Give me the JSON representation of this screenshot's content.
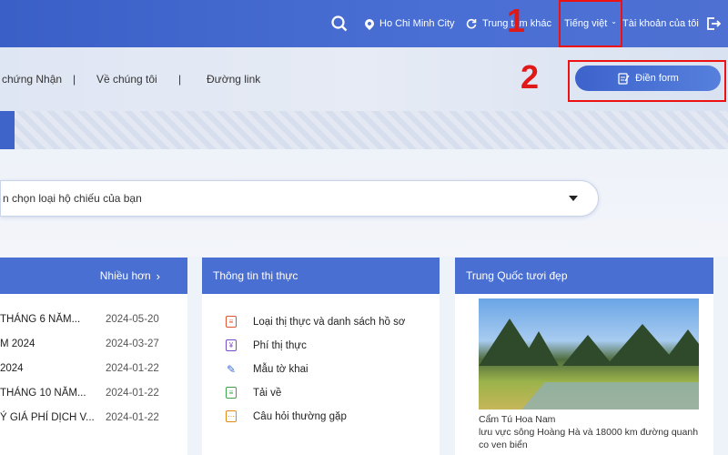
{
  "topbar": {
    "location": "Ho Chi Minh City",
    "other_label": "Trung tâm khác",
    "language": "Tiếng việt",
    "account": "Tài khoản của tôi"
  },
  "annotations": {
    "one": "1",
    "two": "2"
  },
  "nav": {
    "links": [
      "chứng Nhận",
      "Về chúng tôi",
      "Đường link"
    ],
    "separators": [
      "|",
      "|"
    ],
    "fill_form": "Điền form"
  },
  "passport_select": {
    "text": "n chọn loại hộ chiếu của bạn"
  },
  "news": {
    "more": "Nhiều hơn",
    "rows": [
      {
        "title": "THÁNG 6 NĂM...",
        "date": "2024-05-20"
      },
      {
        "title": "M 2024",
        "date": "2024-03-27"
      },
      {
        "title": "2024",
        "date": "2024-01-22"
      },
      {
        "title": "THÁNG 10 NĂM...",
        "date": "2024-01-22"
      },
      {
        "title": "Ý GIÁ PHÍ DỊCH V...",
        "date": "2024-01-22"
      }
    ]
  },
  "visa_info": {
    "title": "Thông tin thị thực",
    "items": [
      {
        "label": "Loại thị thực và danh sách hồ sơ",
        "icon": "list-icon",
        "color": "#e0542f"
      },
      {
        "label": "Phí thị thực",
        "icon": "fee-icon",
        "color": "#7a4bc9"
      },
      {
        "label": "Mẫu tờ khai",
        "icon": "pen-icon",
        "color": "#3d6bd0"
      },
      {
        "label": "Tải về",
        "icon": "download-icon",
        "color": "#3fa24a"
      },
      {
        "label": "Câu hỏi thường gặp",
        "icon": "faq-icon",
        "color": "#e08a1c"
      }
    ]
  },
  "china": {
    "title": "Trung Quốc tươi đẹp",
    "caption1": "Cẩm Tú Hoa Nam",
    "caption2": "lưu vực sông Hoàng Hà và 18000 km đường quanh",
    "caption3": "co ven biển"
  },
  "colors": {
    "primary": "#4a6fd2",
    "highlight": "#e11111"
  }
}
